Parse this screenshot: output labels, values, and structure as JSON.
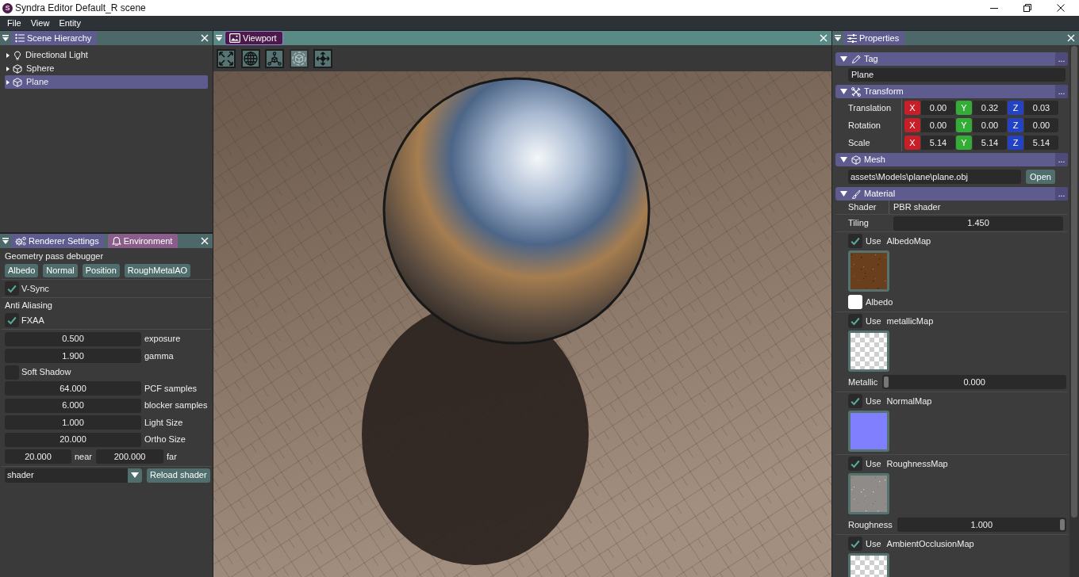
{
  "window": {
    "logo": "S",
    "title": "Syndra Editor Default_R scene"
  },
  "menu": [
    "File",
    "View",
    "Entity"
  ],
  "scene_hierarchy": {
    "focused": false,
    "tabs": [
      {
        "label": "Scene Hierarchy",
        "selected": true
      }
    ],
    "items": [
      {
        "label": "Directional Light",
        "kind": "light",
        "expanded": false,
        "selected": false
      },
      {
        "label": "Sphere",
        "kind": "mesh",
        "expanded": false,
        "selected": false
      },
      {
        "label": "Plane",
        "kind": "mesh",
        "expanded": false,
        "selected": true
      }
    ]
  },
  "renderer_settings": {
    "focused": false,
    "tabs": [
      {
        "label": "Renderer Settings",
        "selected": true
      },
      {
        "label": "Environment",
        "selected": false
      }
    ],
    "sections": [
      [
        {
          "kind": "heading",
          "text": "Geometry pass debugger"
        },
        {
          "kind": "buttons",
          "buttons": [
            "Albedo",
            "Normal",
            "Position",
            "RoughMetalAO"
          ]
        }
      ],
      [
        {
          "kind": "checkbox",
          "text": "V-Sync",
          "checked": true
        }
      ],
      [
        {
          "kind": "heading",
          "text": "Anti Aliasing"
        },
        {
          "kind": "checkbox",
          "text": "FXAA",
          "checked": true
        }
      ],
      [
        {
          "kind": "drag",
          "value": "0.500",
          "label": "exposure"
        },
        {
          "kind": "drag",
          "value": "1.900",
          "label": "gamma"
        },
        {
          "kind": "checkbox",
          "text": "Soft Shadow",
          "checked": false
        },
        {
          "kind": "drag",
          "value": "64.000",
          "label": "PCF samples"
        },
        {
          "kind": "drag",
          "value": "6.000",
          "label": "blocker samples"
        },
        {
          "kind": "drag",
          "value": "1.000",
          "label": "Light Size"
        },
        {
          "kind": "drag",
          "value": "20.000",
          "label": "Ortho Size"
        },
        {
          "kind": "pair",
          "fields": [
            {
              "value": "20.000",
              "label": "near"
            },
            {
              "value": "200.000",
              "label": "far"
            }
          ]
        }
      ],
      [
        {
          "kind": "combo",
          "value": "shader",
          "button": "Reload shader"
        }
      ]
    ]
  },
  "viewport": {
    "focused": true,
    "tabs": [
      {
        "label": "Viewport",
        "selected": true
      }
    ],
    "tools": [
      {
        "disabled": false
      },
      {
        "disabled": false
      },
      {
        "disabled": false
      },
      {
        "disabled": true
      },
      {
        "disabled": false
      }
    ]
  },
  "properties": {
    "focused": false,
    "tabs": [
      {
        "label": "Properties",
        "selected": true
      }
    ],
    "components": [
      {
        "kind": "tag",
        "title": "Tag",
        "expanded": true,
        "menu": "...",
        "value": "Plane"
      },
      {
        "kind": "transform",
        "title": "Transform",
        "expanded": true,
        "menu": "...",
        "rows": [
          {
            "label": "Translation",
            "axes": [
              {
                "axis": "X",
                "color": "#c81e28",
                "value": "0.00"
              },
              {
                "axis": "Y",
                "color": "#34ad36",
                "value": "0.32"
              },
              {
                "axis": "Z",
                "color": "#2343c4",
                "value": "0.03"
              }
            ]
          },
          {
            "label": "Rotation",
            "axes": [
              {
                "axis": "X",
                "color": "#c81e28",
                "value": "0.00"
              },
              {
                "axis": "Y",
                "color": "#34ad36",
                "value": "0.00"
              },
              {
                "axis": "Z",
                "color": "#2343c4",
                "value": "0.00"
              }
            ]
          },
          {
            "label": "Scale",
            "axes": [
              {
                "axis": "X",
                "color": "#c81e28",
                "value": "5.14"
              },
              {
                "axis": "Y",
                "color": "#34ad36",
                "value": "5.14"
              },
              {
                "axis": "Z",
                "color": "#2343c4",
                "value": "5.14"
              }
            ]
          }
        ]
      },
      {
        "kind": "mesh",
        "title": "Mesh",
        "expanded": true,
        "menu": "...",
        "path": "assets\\Models\\plane\\plane.obj",
        "button": "Open"
      },
      {
        "kind": "material",
        "title": "Material",
        "expanded": true,
        "menu": "...",
        "shader_label": "Shader",
        "shader": "PBR shader",
        "tiling_label": "Tiling",
        "tiling": "1.450",
        "maps": [
          {
            "kind": "color",
            "checked": true,
            "use": "Use",
            "name": "AlbedoMap",
            "label": "Albedo",
            "color": "#ffffff"
          },
          {
            "kind": "slider",
            "checked": true,
            "use": "Use",
            "name": "metallicMap",
            "label": "Metallic",
            "value": "0.000",
            "level": 0
          },
          {
            "kind": "plain",
            "checked": true,
            "use": "Use",
            "name": "NormalMap"
          },
          {
            "kind": "slider",
            "checked": true,
            "use": "Use",
            "name": "RoughnessMap",
            "label": "Roughness",
            "value": "1.000",
            "level": 1
          },
          {
            "kind": "plain",
            "checked": true,
            "use": "Use",
            "name": "AmbientOcclusionMap"
          }
        ]
      }
    ]
  }
}
